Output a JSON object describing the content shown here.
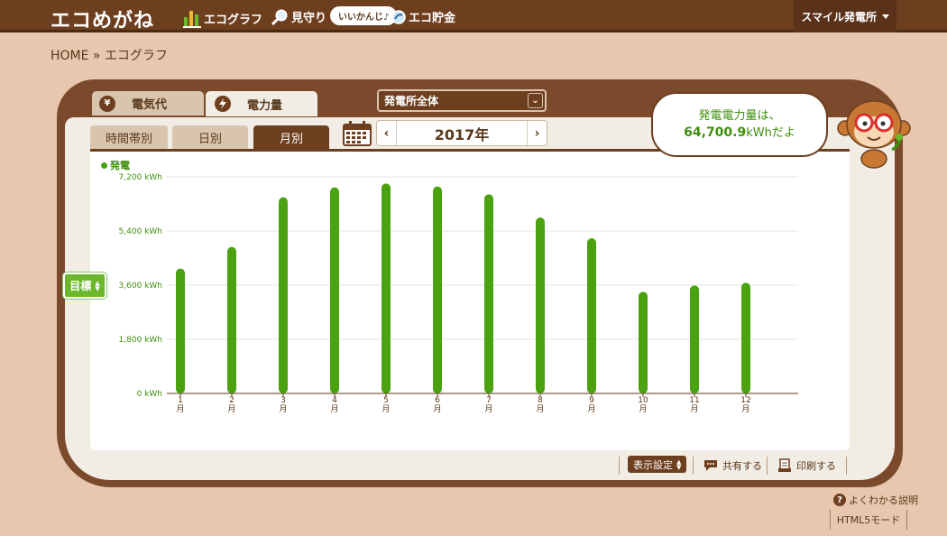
{
  "header": {
    "logo": "エコめがね",
    "nav": {
      "graph": "エコグラフ",
      "mimamori": "見守り",
      "bubble": "いいかんじ♪",
      "chokin": "エコ貯金"
    },
    "site_select": "スマイル発電所"
  },
  "breadcrumb": "HOME » エコグラフ",
  "tabs": {
    "denkidai": "電気代",
    "denkidai_icon": "¥",
    "denryoku": "電力量"
  },
  "scope_select": "発電所全体",
  "period_tabs": {
    "hour": "時間帯別",
    "day": "日別",
    "month": "月別"
  },
  "year": "2017年",
  "speech": {
    "line1": "発電電力量は、",
    "value": "64,700.9",
    "unit": "kWhだよ"
  },
  "target_button": "目標",
  "controls": {
    "display_settings": "表示設定",
    "share": "共有する",
    "print": "印刷する"
  },
  "footer": {
    "help": "よくわかる説明",
    "html5": "HTML5モード"
  },
  "colors": {
    "bar": "#4aa210",
    "brown": "#6e3f1f",
    "label_green": "#3e8f0a"
  },
  "chart_data": {
    "type": "bar",
    "legend": "発電",
    "categories": [
      "1月",
      "2月",
      "3月",
      "4月",
      "5月",
      "6月",
      "7月",
      "8月",
      "9月",
      "10月",
      "11月",
      "12月"
    ],
    "x_month_labels": [
      "1",
      "2",
      "3",
      "4",
      "5",
      "6",
      "7",
      "8",
      "9",
      "10",
      "11",
      "12"
    ],
    "x_unit_label": "月",
    "values": [
      4150,
      4870,
      6520,
      6850,
      6980,
      6880,
      6620,
      5850,
      5160,
      3380,
      3590,
      3680
    ],
    "ylim": [
      0,
      7200
    ],
    "yticks": [
      0,
      1800,
      3600,
      5400,
      7200
    ],
    "ytick_labels": [
      "0 kWh",
      "1,800 kWh",
      "3,600 kWh",
      "5,400 kWh",
      "7,200 kWh"
    ],
    "grid": true
  }
}
